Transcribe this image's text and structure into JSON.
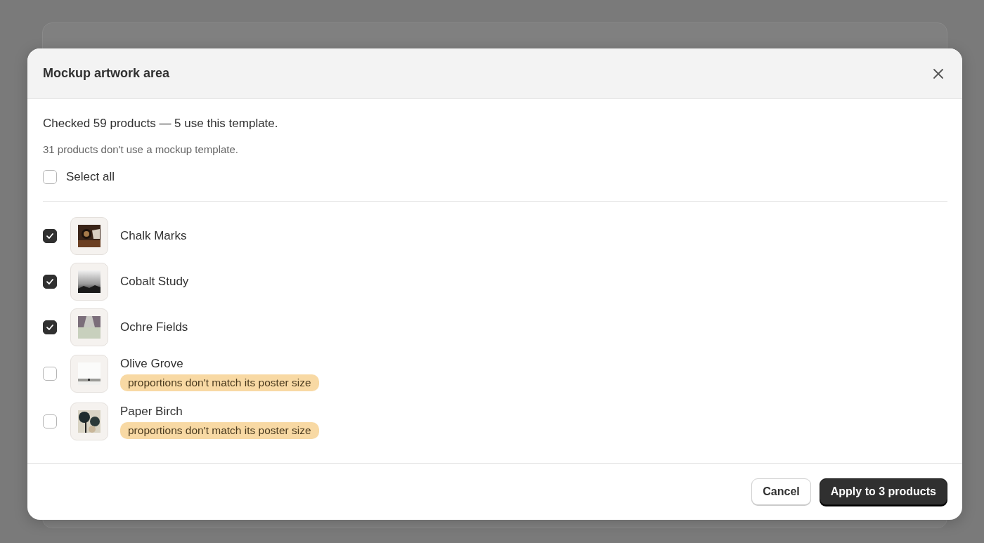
{
  "dialog": {
    "title": "Mockup artwork area",
    "summary": "Checked 59 products — 5 use this template.",
    "note": "31 products don't use a mockup template.",
    "select_all": {
      "label": "Select all",
      "checked": false
    },
    "products": [
      {
        "name": "Chalk Marks",
        "checked": true
      },
      {
        "name": "Cobalt Study",
        "checked": true
      },
      {
        "name": "Ochre Fields",
        "checked": true
      },
      {
        "name": "Olive Grove",
        "checked": false,
        "badge": "proportions don't match its poster size"
      },
      {
        "name": "Paper Birch",
        "checked": false,
        "badge": "proportions don't match its poster size"
      }
    ],
    "buttons": [
      {
        "label": "Cancel",
        "kind": "secondary"
      },
      {
        "label": "Apply to 3 products",
        "kind": "primary"
      }
    ]
  }
}
